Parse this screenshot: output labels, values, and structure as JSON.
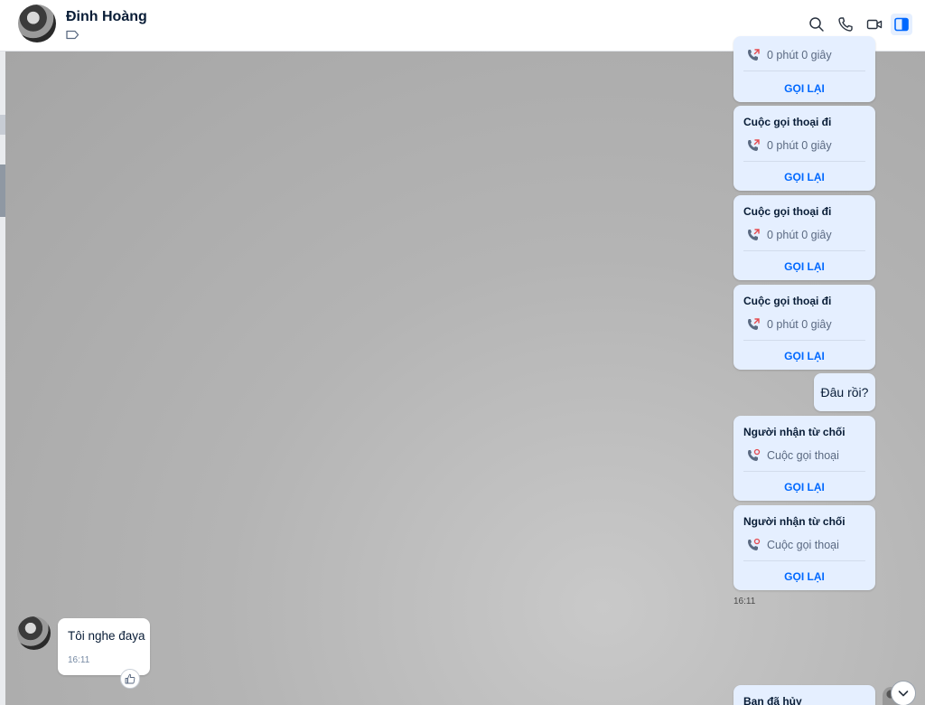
{
  "header": {
    "contact_name": "Đinh Hoàng",
    "icons": [
      "tag-icon",
      "search-icon",
      "phone-icon",
      "video-icon",
      "side-panel-icon"
    ],
    "accent": "#0068ff"
  },
  "messages": {
    "call_cards": [
      {
        "title": "",
        "detail": "0 phút 0 giây",
        "action": "GỌI LẠI",
        "kind": "outgoing"
      },
      {
        "title": "Cuộc gọi thoại đi",
        "detail": "0 phút 0 giây",
        "action": "GỌI LẠI",
        "kind": "outgoing"
      },
      {
        "title": "Cuộc gọi thoại đi",
        "detail": "0 phút 0 giây",
        "action": "GỌI LẠI",
        "kind": "outgoing"
      },
      {
        "title": "Cuộc gọi thoại đi",
        "detail": "0 phút 0 giây",
        "action": "GỌI LẠI",
        "kind": "outgoing"
      },
      {
        "title": "Người nhận từ chối",
        "detail": "Cuộc gọi thoại",
        "action": "GỌI LẠI",
        "kind": "declined"
      },
      {
        "title": "Người nhận từ chối",
        "detail": "Cuộc gọi thoại",
        "action": "GỌI LẠI",
        "kind": "declined"
      },
      {
        "title": "Bạn đã hủy",
        "detail": "",
        "action": "",
        "kind": "cancelled"
      }
    ],
    "sent_text": "Đâu rồi?",
    "sent_time": "16:11",
    "received_text": "Tôi nghe đaya",
    "received_time": "16:11"
  },
  "colors": {
    "bubble_sent": "#e5efff",
    "callback_link": "#0068ff",
    "missed_call_red": "#e5484d"
  }
}
